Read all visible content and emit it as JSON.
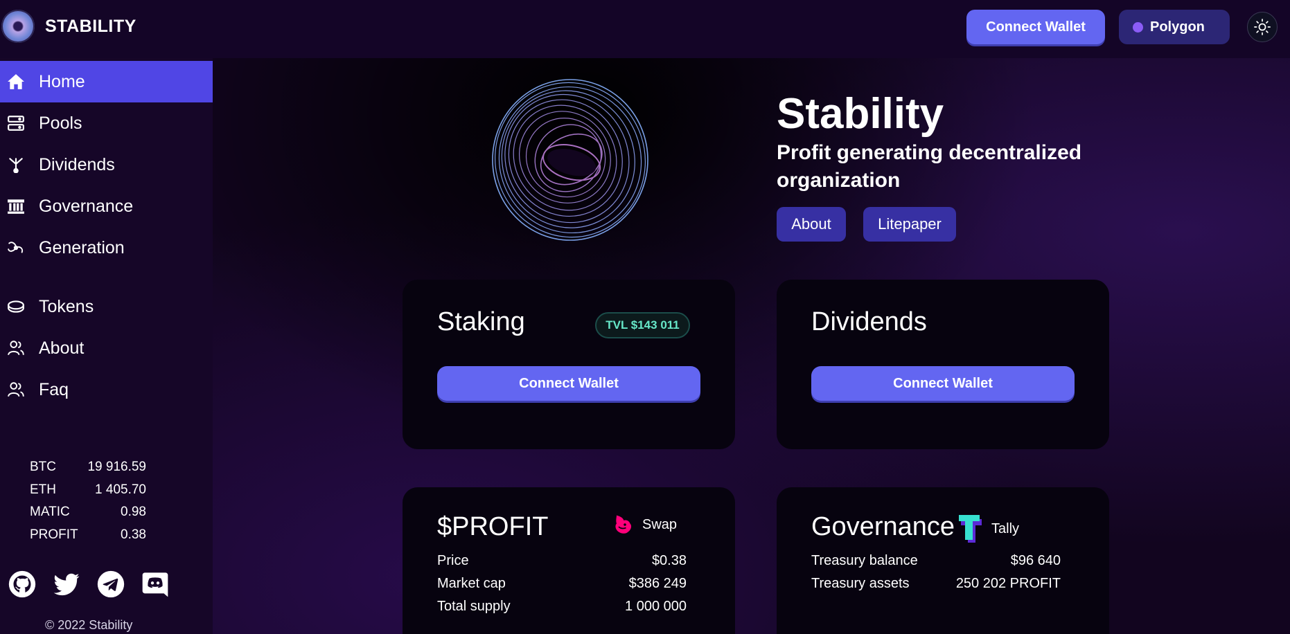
{
  "header": {
    "brand": "STABILITY",
    "connect_label": "Connect Wallet",
    "network_label": "Polygon",
    "network_color": "#8b5cf6",
    "theme_icon": "sun-icon"
  },
  "sidebar": {
    "items": [
      {
        "label": "Home",
        "icon": "home-icon",
        "active": true
      },
      {
        "label": "Pools",
        "icon": "server-icon"
      },
      {
        "label": "Dividends",
        "icon": "split-icon"
      },
      {
        "label": "Governance",
        "icon": "bank-icon"
      },
      {
        "label": "Generation",
        "icon": "swirl-icon"
      },
      {
        "label": "Tokens",
        "icon": "coin-icon"
      },
      {
        "label": "About",
        "icon": "users-icon"
      },
      {
        "label": "Faq",
        "icon": "users-icon"
      }
    ],
    "prices": [
      {
        "symbol": "BTC",
        "value": "19 916.59"
      },
      {
        "symbol": "ETH",
        "value": "1 405.70"
      },
      {
        "symbol": "MATIC",
        "value": "0.98"
      },
      {
        "symbol": "PROFIT",
        "value": "0.38"
      }
    ],
    "socials": [
      "github-icon",
      "twitter-icon",
      "telegram-icon",
      "discord-icon"
    ],
    "copyright": "© 2022 Stability"
  },
  "hero": {
    "title": "Stability",
    "subtitle": "Profit generating decentralized organization",
    "about_label": "About",
    "litepaper_label": "Litepaper"
  },
  "staking": {
    "title": "Staking",
    "tvl": "TVL $143 011",
    "button": "Connect Wallet"
  },
  "dividends": {
    "title": "Dividends",
    "button": "Connect Wallet"
  },
  "profit": {
    "title": "$PROFIT",
    "link_label": "Swap",
    "link_icon": "uniswap-icon",
    "rows": [
      {
        "label": "Price",
        "value": "$0.38"
      },
      {
        "label": "Market cap",
        "value": "$386 249"
      },
      {
        "label": "Total supply",
        "value": "1 000 000"
      }
    ]
  },
  "governance": {
    "title": "Governance",
    "link_label": "Tally",
    "link_icon": "tally-icon",
    "rows": [
      {
        "label": "Treasury balance",
        "value": "$96 640"
      },
      {
        "label": "Treasury assets",
        "value": "250 202 PROFIT"
      }
    ]
  },
  "colors": {
    "accent": "#6366f1",
    "active_nav": "#5046e5",
    "hero_button": "#3730a3",
    "tvl_text": "#67e8c9"
  }
}
